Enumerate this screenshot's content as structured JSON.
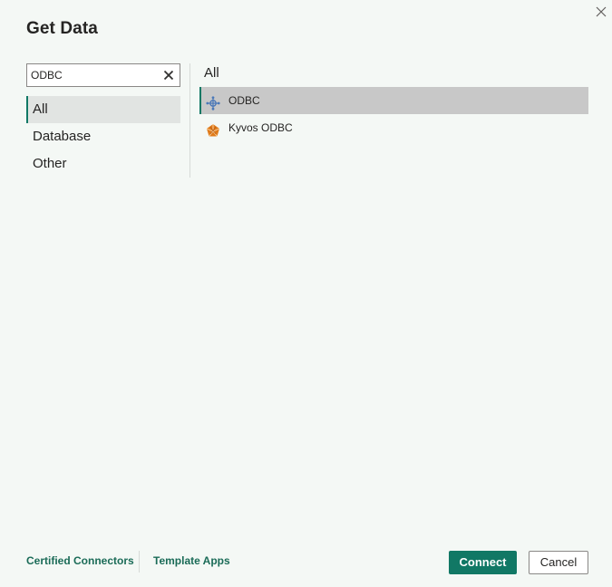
{
  "dialog": {
    "title": "Get Data",
    "close_icon": "close-icon"
  },
  "search": {
    "value": "ODBC",
    "clear_icon": "clear-icon"
  },
  "categories": [
    {
      "label": "All",
      "selected": true
    },
    {
      "label": "Database",
      "selected": false
    },
    {
      "label": "Other",
      "selected": false
    }
  ],
  "results": {
    "heading": "All",
    "items": [
      {
        "label": "ODBC",
        "icon": "odbc-icon",
        "selected": true
      },
      {
        "label": "Kyvos ODBC",
        "icon": "kyvos-odbc-icon",
        "selected": false
      }
    ]
  },
  "footer": {
    "certified_connectors": "Certified Connectors",
    "template_apps": "Template Apps",
    "connect": "Connect",
    "cancel": "Cancel"
  },
  "colors": {
    "accent": "#117865",
    "link": "#1a6b57",
    "selected_row": "#c8c8c8",
    "background": "#f4f8f5"
  }
}
